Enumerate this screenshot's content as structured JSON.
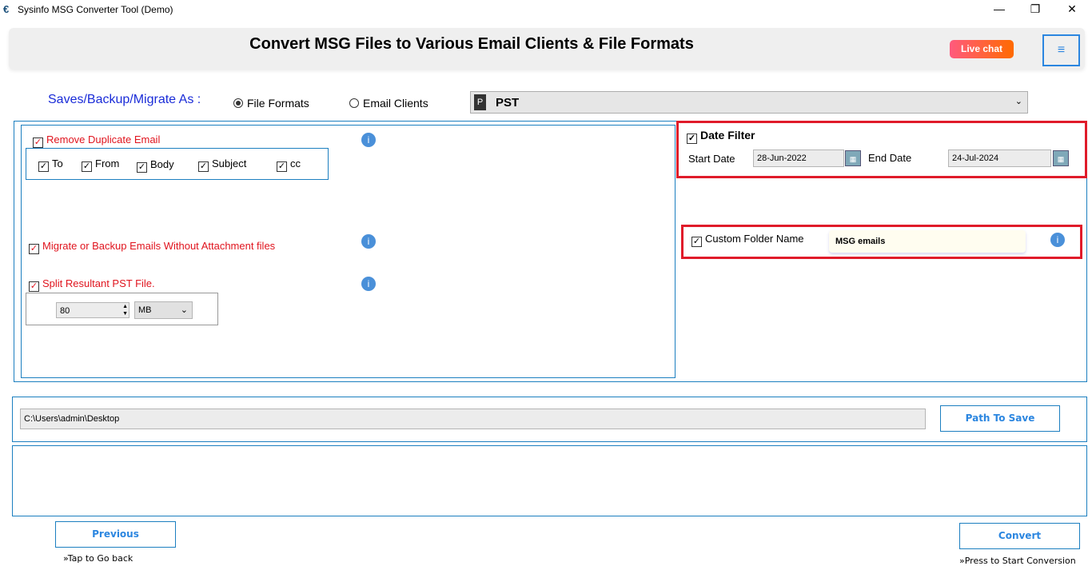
{
  "window": {
    "title": "Sysinfo MSG Converter Tool (Demo)",
    "minimize": "—",
    "restore": "❐",
    "close": "✕"
  },
  "header": {
    "title": "Convert MSG Files to Various Email Clients & File Formats",
    "live_chat": "Live chat",
    "menu_icon": "≡"
  },
  "save_as": {
    "label": "Saves/Backup/Migrate As :",
    "options": [
      {
        "label": "File Formats",
        "selected": true
      },
      {
        "label": "Email Clients",
        "selected": false
      }
    ],
    "format_selected": "PST"
  },
  "left": {
    "remove_duplicate": {
      "label": "Remove Duplicate Email",
      "checked": true,
      "fields": [
        {
          "label": "To",
          "checked": true
        },
        {
          "label": "From",
          "checked": true
        },
        {
          "label": "Body",
          "checked": true
        },
        {
          "label": "Subject",
          "checked": true
        },
        {
          "label": "cc",
          "checked": true
        }
      ]
    },
    "without_attachment": {
      "label": "Migrate or Backup Emails Without Attachment files",
      "checked": true
    },
    "split": {
      "label": "Split Resultant PST File.",
      "checked": true,
      "size": "80",
      "unit": "MB"
    }
  },
  "right": {
    "date_filter": {
      "label": "Date Filter",
      "checked": true,
      "start_label": "Start Date",
      "start": "28-Jun-2022",
      "end_label": "End Date",
      "end": "24-Jul-2024"
    },
    "custom_folder": {
      "label": "Custom Folder Name",
      "checked": true,
      "value": "MSG emails"
    }
  },
  "path": {
    "value": "C:\\Users\\admin\\Desktop",
    "button": "Path To Save"
  },
  "footer": {
    "previous": "Previous",
    "previous_hint": "»Tap to Go back",
    "convert": "Convert",
    "convert_hint": "»Press to Start Conversion"
  },
  "check": "✓",
  "info": "i"
}
